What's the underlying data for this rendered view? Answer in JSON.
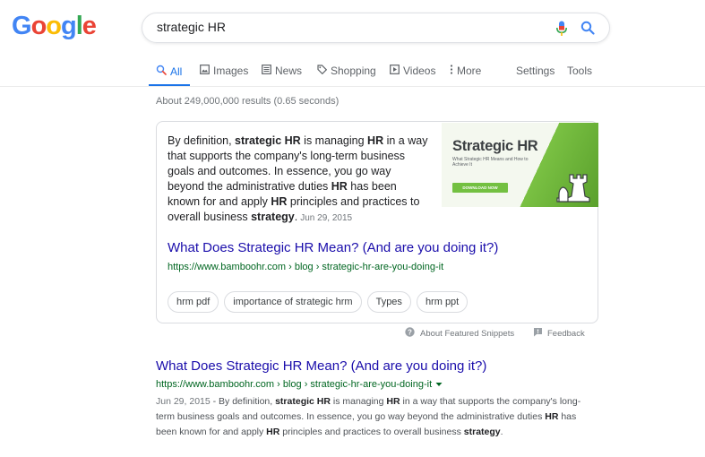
{
  "logo": {
    "letters": [
      "G",
      "o",
      "o",
      "g",
      "l",
      "e"
    ],
    "colors": [
      "#4285F4",
      "#EA4335",
      "#FBBC05",
      "#4285F4",
      "#34A853",
      "#EA4335"
    ]
  },
  "search": {
    "query": "strategic HR",
    "mic_icon": "mic-icon",
    "search_icon": "search-icon"
  },
  "tabs": {
    "items": [
      {
        "label": "All",
        "icon": "search-icon",
        "active": true
      },
      {
        "label": "Images",
        "icon": "image-icon"
      },
      {
        "label": "News",
        "icon": "newspaper-icon"
      },
      {
        "label": "Shopping",
        "icon": "tag-icon"
      },
      {
        "label": "Videos",
        "icon": "play-icon"
      },
      {
        "label": "More",
        "icon": "more-vert-icon"
      }
    ],
    "settings": "Settings",
    "tools": "Tools",
    "accent": "#1a73e8"
  },
  "stats": "About 249,000,000 results (0.65 seconds)",
  "featured_snippet": {
    "segments": [
      {
        "text": "By definition, ",
        "b": false
      },
      {
        "text": "strategic HR",
        "b": true
      },
      {
        "text": " is managing ",
        "b": false
      },
      {
        "text": "HR",
        "b": true
      },
      {
        "text": " in a way that supports the company's long-term business goals and outcomes. In essence, you go way beyond the administrative duties ",
        "b": false
      },
      {
        "text": "HR",
        "b": true
      },
      {
        "text": " has been known for and apply ",
        "b": false
      },
      {
        "text": "HR",
        "b": true
      },
      {
        "text": " principles and practices to overall business ",
        "b": false
      },
      {
        "text": "strategy",
        "b": true
      },
      {
        "text": ".",
        "b": false
      }
    ],
    "date": "Jun 29, 2015",
    "image": {
      "title": "Strategic HR",
      "subtitle": "What Strategic HR Means and How to Achieve It",
      "button": "DOWNLOAD NOW"
    },
    "link_title": "What Does Strategic HR Mean? (And are you doing it?)",
    "url": "https://www.bamboohr.com › blog › strategic-hr-are-you-doing-it",
    "chips": [
      "hrm pdf",
      "importance of strategic hrm",
      "Types",
      "hrm ppt"
    ],
    "about": "About Featured Snippets",
    "feedback": "Feedback"
  },
  "result": {
    "title": "What Does Strategic HR Mean? (And are you doing it?)",
    "url": "https://www.bamboohr.com › blog › strategic-hr-are-you-doing-it",
    "date": "Jun 29, 2015",
    "segments": [
      {
        "text": " - By definition, ",
        "b": false
      },
      {
        "text": "strategic HR",
        "b": true
      },
      {
        "text": " is managing ",
        "b": false
      },
      {
        "text": "HR",
        "b": true
      },
      {
        "text": " in a way that supports the company's long-term business goals and outcomes. In essence, you go way beyond the administrative duties ",
        "b": false
      },
      {
        "text": "HR",
        "b": true
      },
      {
        "text": " has been known for and apply ",
        "b": false
      },
      {
        "text": "HR",
        "b": true
      },
      {
        "text": " principles and practices to overall business ",
        "b": false
      },
      {
        "text": "strategy",
        "b": true
      },
      {
        "text": ".",
        "b": false
      }
    ]
  }
}
